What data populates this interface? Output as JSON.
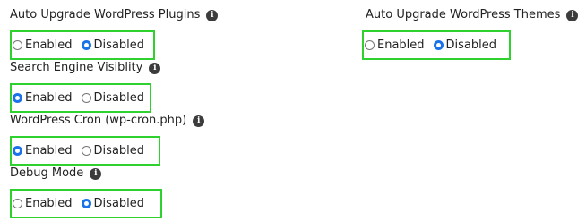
{
  "settings": [
    {
      "title": "Auto Upgrade WordPress Plugins",
      "info_icon": "info-icon",
      "options": [
        {
          "label": "Enabled",
          "checked": false
        },
        {
          "label": "Disabled",
          "checked": true
        }
      ]
    },
    {
      "title": "Search Engine Visiblity",
      "info_icon": "info-icon",
      "options": [
        {
          "label": "Enabled",
          "checked": true
        },
        {
          "label": "Disabled",
          "checked": false
        }
      ]
    },
    {
      "title": "WordPress Cron (wp-cron.php)",
      "info_icon": "info-icon",
      "options": [
        {
          "label": "Enabled",
          "checked": true
        },
        {
          "label": "Disabled",
          "checked": false
        }
      ]
    },
    {
      "title": "Debug Mode",
      "info_icon": "info-icon",
      "options": [
        {
          "label": "Enabled",
          "checked": false
        },
        {
          "label": "Disabled",
          "checked": true
        }
      ]
    },
    {
      "title": "Auto Upgrade WordPress Themes",
      "info_icon": "info-icon",
      "options": [
        {
          "label": "Enabled",
          "checked": false
        },
        {
          "label": "Disabled",
          "checked": true
        }
      ]
    }
  ],
  "colors": {
    "highlight_border": "#2ed12e",
    "radio_checked": "#1a73e8",
    "info_icon_bg": "#3c3c3c"
  }
}
